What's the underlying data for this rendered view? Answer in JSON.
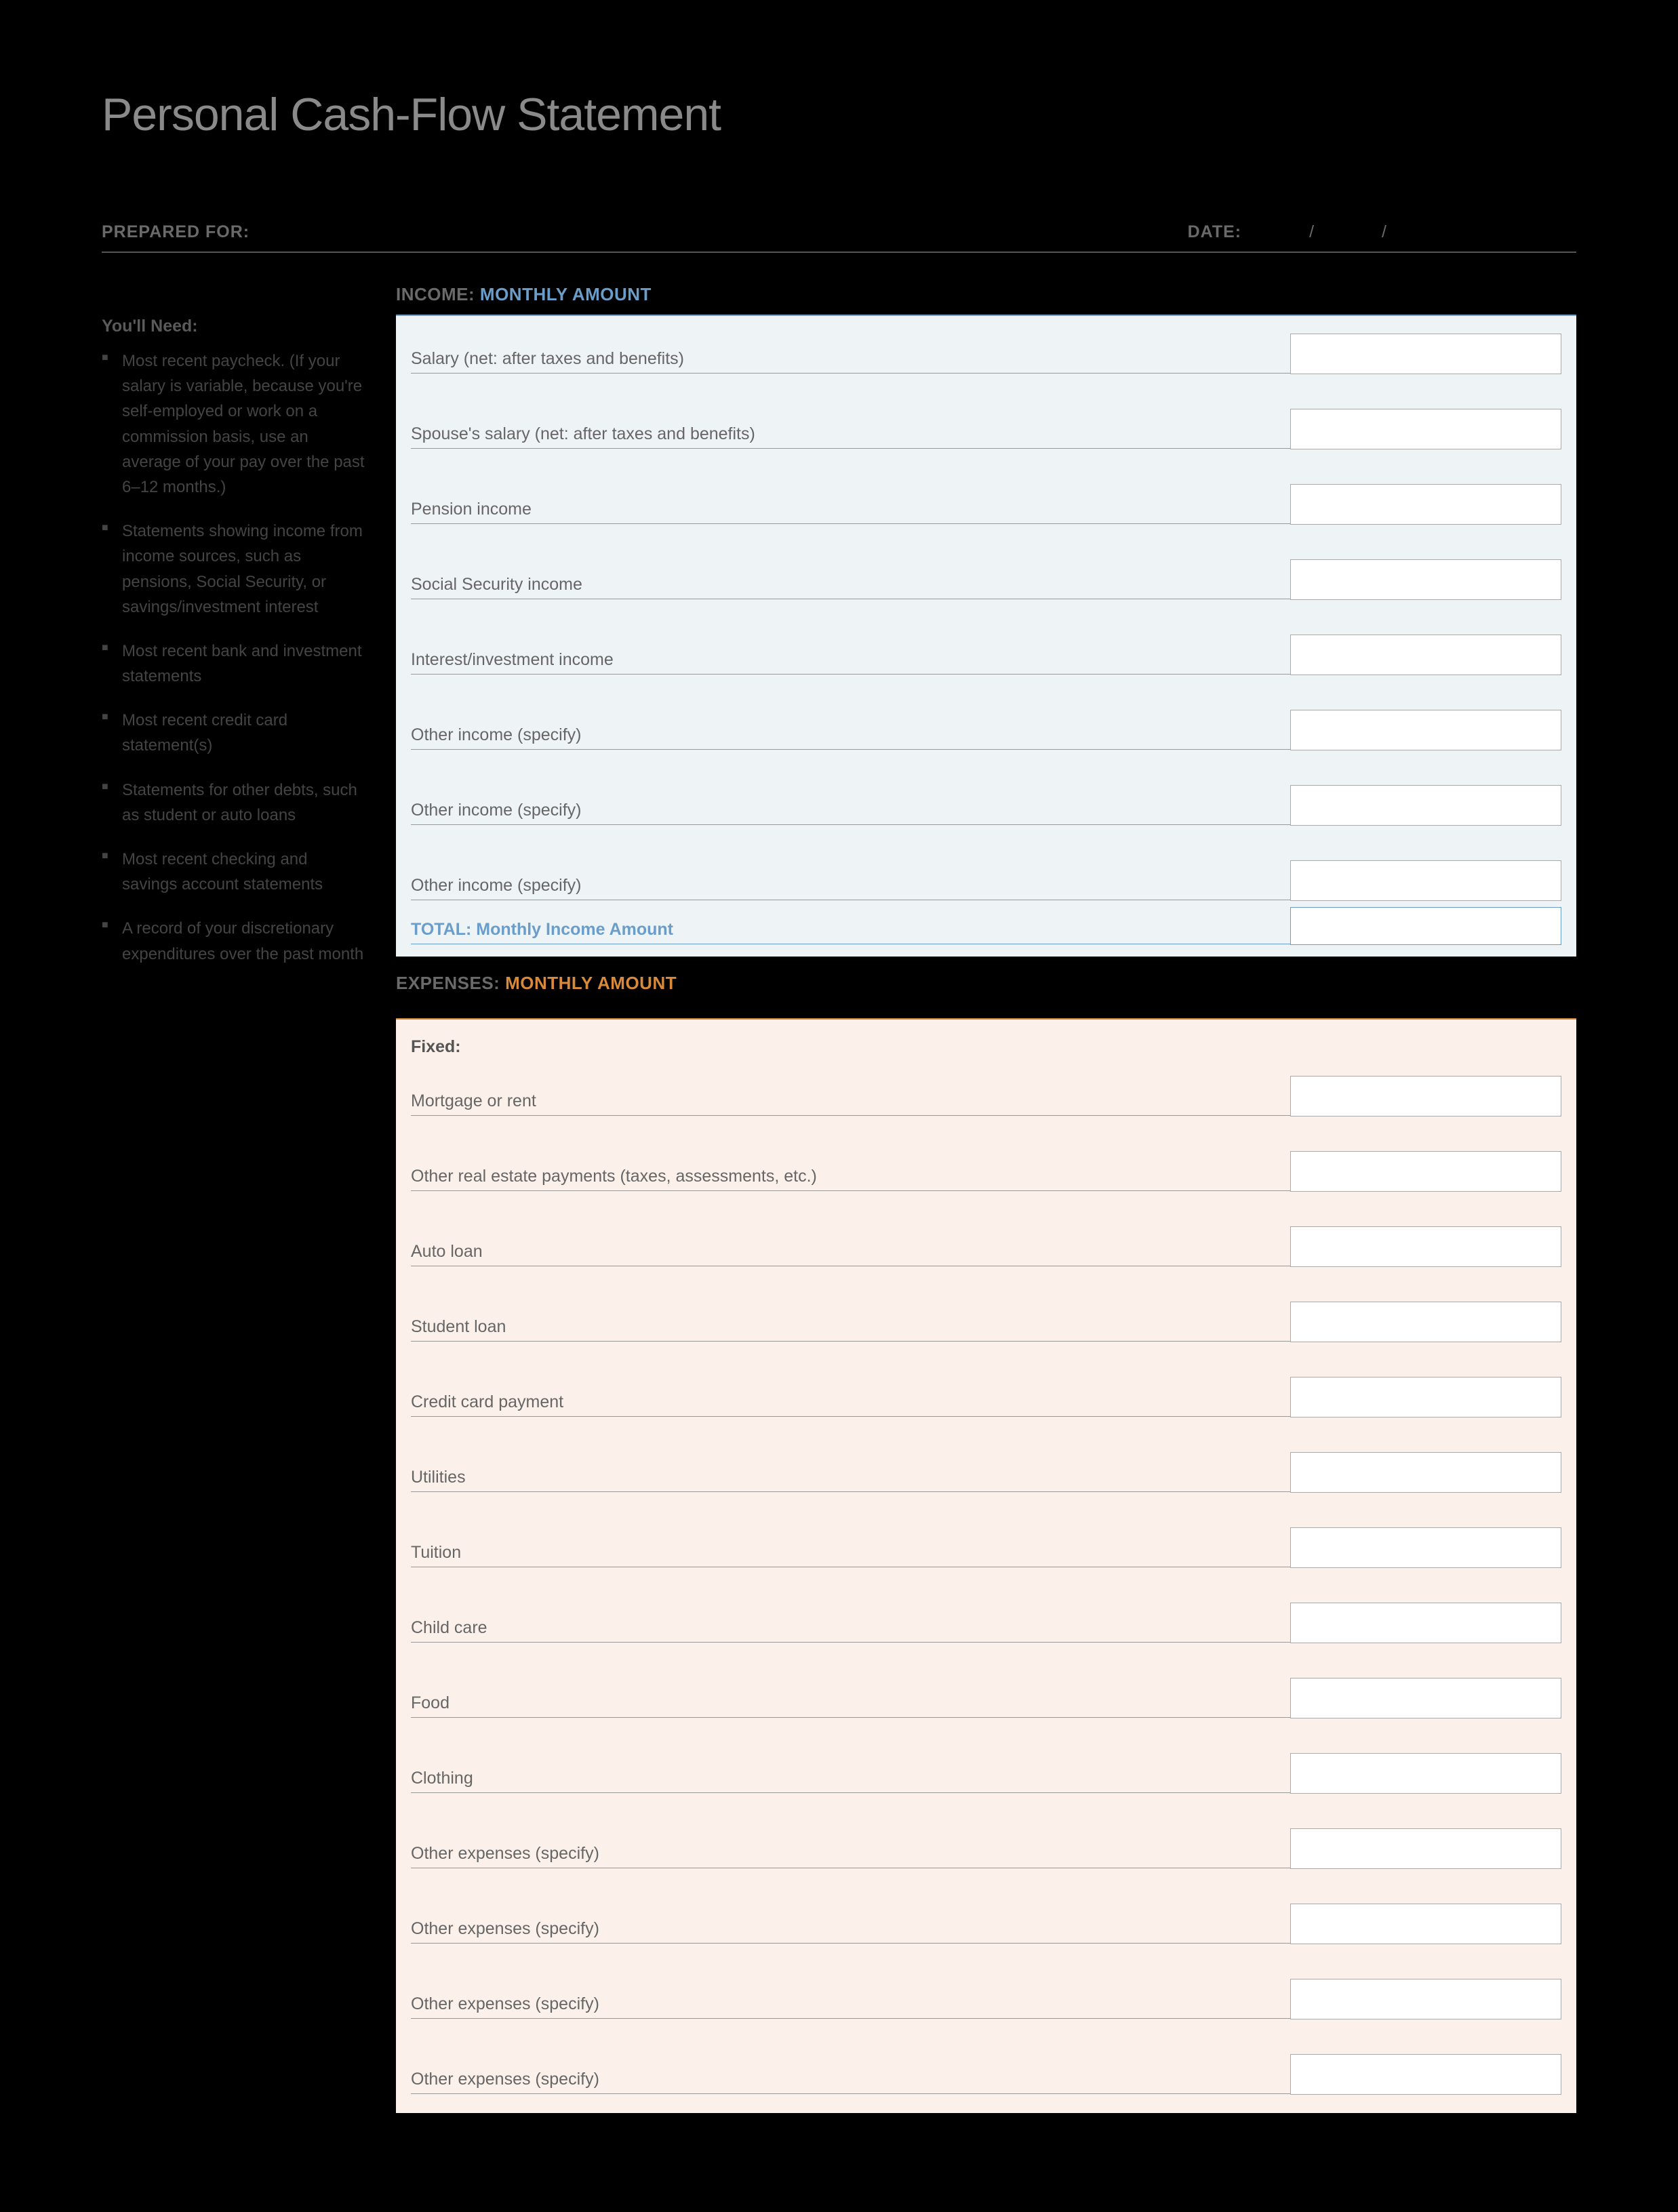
{
  "title": "Personal Cash-Flow Statement",
  "header": {
    "prepared_for_label": "PREPARED FOR:",
    "date_label": "DATE:",
    "slash": "/"
  },
  "sidebar": {
    "heading": "You'll Need:",
    "items": [
      "Most recent paycheck. (If your salary is variable, because you're self-employed or work on a commission basis, use an average of your pay over the past 6–12 months.)",
      "Statements showing income from income sources, such as pensions, Social Security, or savings/investment interest",
      "Most recent bank and investment statements",
      "Most recent credit card statement(s)",
      "Statements for other debts, such as student or auto loans",
      "Most recent checking and savings account statements",
      "A record of your discretionary expenditures over the past month"
    ]
  },
  "income": {
    "label_a": "INCOME:",
    "label_b": "MONTHLY AMOUNT",
    "rows": [
      "Salary (net: after taxes and benefits)",
      "Spouse's salary (net: after taxes and benefits)",
      "Pension income",
      "Social Security income",
      "Interest/investment income",
      "Other income (specify)",
      "Other income (specify)",
      "Other income (specify)"
    ],
    "total_label": "TOTAL: Monthly Income Amount"
  },
  "expenses": {
    "label_a": "EXPENSES:",
    "label_b": "MONTHLY AMOUNT",
    "subheading": "Fixed:",
    "rows": [
      "Mortgage or rent",
      "Other real estate payments (taxes, assessments, etc.)",
      "Auto loan",
      "Student loan",
      "Credit card payment",
      "Utilities",
      "Tuition",
      "Child care",
      "Food",
      "Clothing",
      "Other expenses (specify)",
      "Other expenses (specify)",
      "Other expenses (specify)",
      "Other expenses (specify)"
    ]
  }
}
